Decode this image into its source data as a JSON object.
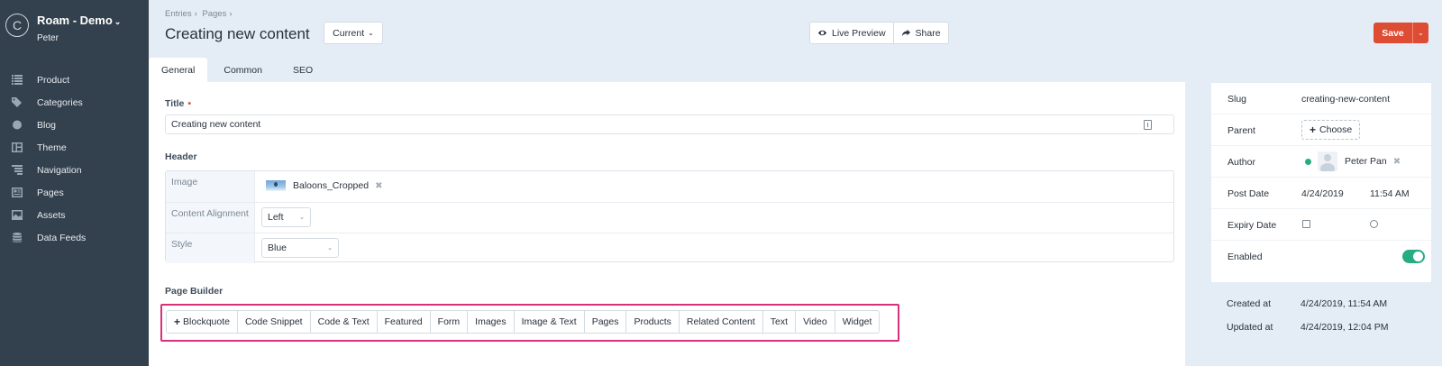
{
  "site": {
    "logo_letter": "C",
    "name": "Roam - Demo",
    "user": "Peter"
  },
  "nav": [
    {
      "label": "Product",
      "icon": "list-icon"
    },
    {
      "label": "Categories",
      "icon": "tags-icon"
    },
    {
      "label": "Blog",
      "icon": "circle-icon"
    },
    {
      "label": "Theme",
      "icon": "layout-icon"
    },
    {
      "label": "Navigation",
      "icon": "tree-icon"
    },
    {
      "label": "Pages",
      "icon": "pages-icon"
    },
    {
      "label": "Assets",
      "icon": "image-icon"
    },
    {
      "label": "Data Feeds",
      "icon": "database-icon"
    }
  ],
  "header": {
    "breadcrumb": [
      "Entries",
      "Pages"
    ],
    "title": "Creating new content",
    "revision_label": "Current",
    "live_preview": "Live Preview",
    "share": "Share",
    "save": "Save"
  },
  "tabs": [
    "General",
    "Common",
    "SEO"
  ],
  "fields": {
    "title_label": "Title",
    "title_value": "Creating new content",
    "header_label": "Header",
    "header_rows": {
      "image_label": "Image",
      "image_value": "Baloons_Cropped",
      "alignment_label": "Content Alignment",
      "alignment_value": "Left",
      "style_label": "Style",
      "style_value": "Blue"
    },
    "page_builder_label": "Page Builder",
    "block_types": [
      "Blockquote",
      "Code Snippet",
      "Code & Text",
      "Featured",
      "Form",
      "Images",
      "Image & Text",
      "Pages",
      "Products",
      "Related Content",
      "Text",
      "Video",
      "Widget"
    ]
  },
  "meta": {
    "slug_label": "Slug",
    "slug_value": "creating-new-content",
    "parent_label": "Parent",
    "parent_button": "Choose",
    "author_label": "Author",
    "author_name": "Peter Pan",
    "post_date_label": "Post Date",
    "post_date": "4/24/2019",
    "post_time": "11:54 AM",
    "expiry_label": "Expiry Date",
    "enabled_label": "Enabled",
    "enabled": true
  },
  "timestamps": {
    "created_label": "Created at",
    "created_value": "4/24/2019, 11:54 AM",
    "updated_label": "Updated at",
    "updated_value": "4/24/2019, 12:04 PM"
  },
  "colors": {
    "sidebar_bg": "#33404d",
    "accent_red": "#dd4c33",
    "enabled_green": "#27ab83",
    "highlight_pink": "#d8307a"
  }
}
